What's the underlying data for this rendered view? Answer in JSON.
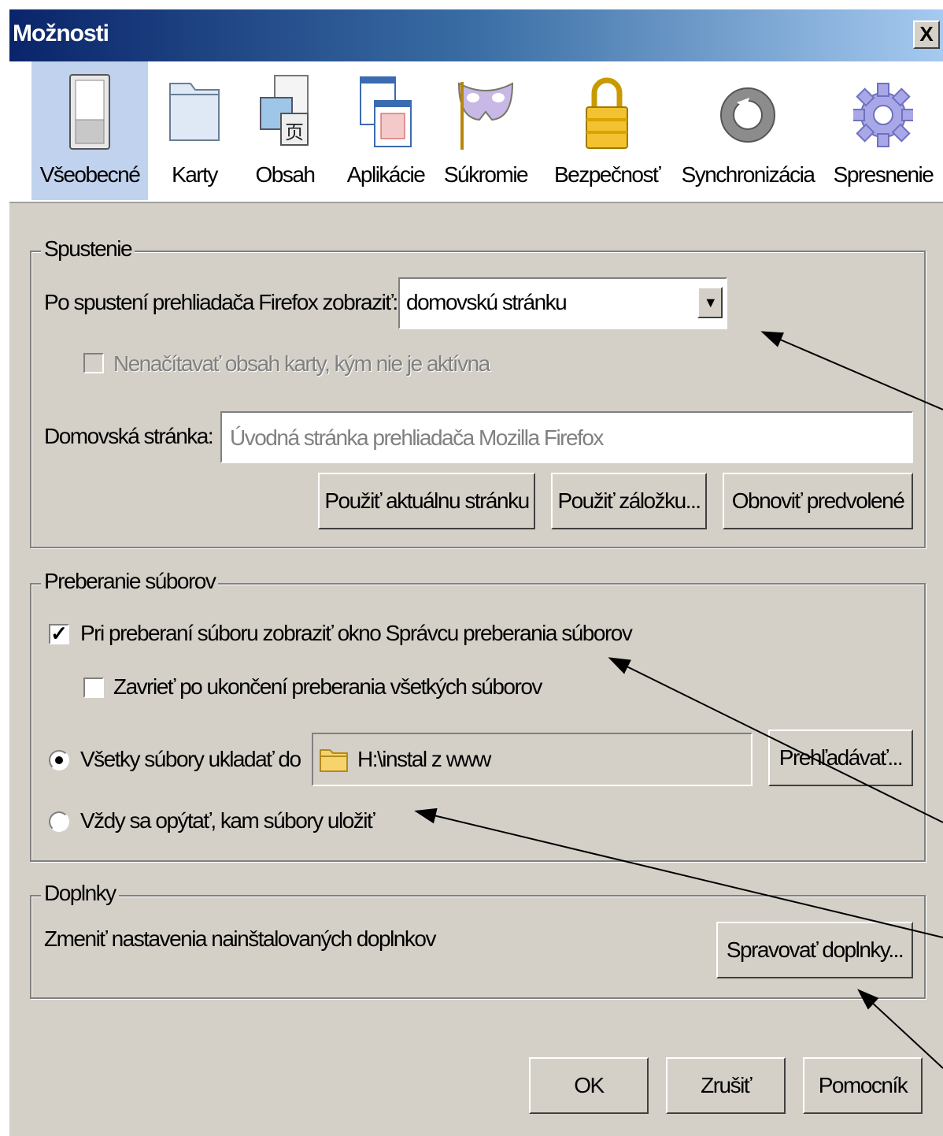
{
  "window": {
    "title": "Možnosti",
    "close_label": "X"
  },
  "tabs": [
    {
      "label": "Všeobecné",
      "icon": "switch-icon",
      "selected": true
    },
    {
      "label": "Karty",
      "icon": "tabs-folder-icon"
    },
    {
      "label": "Obsah",
      "icon": "content-icon"
    },
    {
      "label": "Aplikácie",
      "icon": "applications-icon"
    },
    {
      "label": "Súkromie",
      "icon": "privacy-mask-icon"
    },
    {
      "label": "Bezpečnosť",
      "icon": "padlock-icon"
    },
    {
      "label": "Synchronizácia",
      "icon": "sync-icon"
    },
    {
      "label": "Spresnenie",
      "icon": "gear-icon"
    }
  ],
  "startup": {
    "legend": "Spustenie",
    "show_label": "Po spustení prehliadača Firefox zobraziť:",
    "show_value": "domovskú stránku",
    "dont_load_tabs_label": "Nenačítavať obsah karty, kým nie je aktívna",
    "homepage_label": "Domovská stránka:",
    "homepage_value": "Úvodná stránka prehliadača Mozilla Firefox",
    "use_current_label": "Použiť aktuálnu stránku",
    "use_bookmark_label": "Použiť záložku...",
    "restore_default_label": "Obnoviť predvolené"
  },
  "downloads": {
    "legend": "Preberanie súborov",
    "show_manager_label": "Pri preberaní súboru zobraziť okno Správcu preberania súborov",
    "show_manager_checked": true,
    "close_when_done_label": "Zavrieť po ukončení preberania všetkých súborov",
    "close_when_done_checked": false,
    "save_to_label": "Všetky súbory ukladať do",
    "save_to_path": "H:\\instal z www",
    "browse_label": "Prehľadávať...",
    "always_ask_label": "Vždy sa opýtať, kam súbory uložiť"
  },
  "addons": {
    "legend": "Doplnky",
    "description": "Zmeniť nastavenia nainštalovaných doplnkov",
    "manage_label": "Spravovať doplnky..."
  },
  "footer": {
    "ok_label": "OK",
    "cancel_label": "Zrušiť",
    "help_label": "Pomocník"
  },
  "colors": {
    "dialog_bg": "#d4d0c8",
    "titlebar_start": "#0a246a",
    "titlebar_end": "#a6caf0",
    "selected_tab": "#c1d2ee"
  }
}
